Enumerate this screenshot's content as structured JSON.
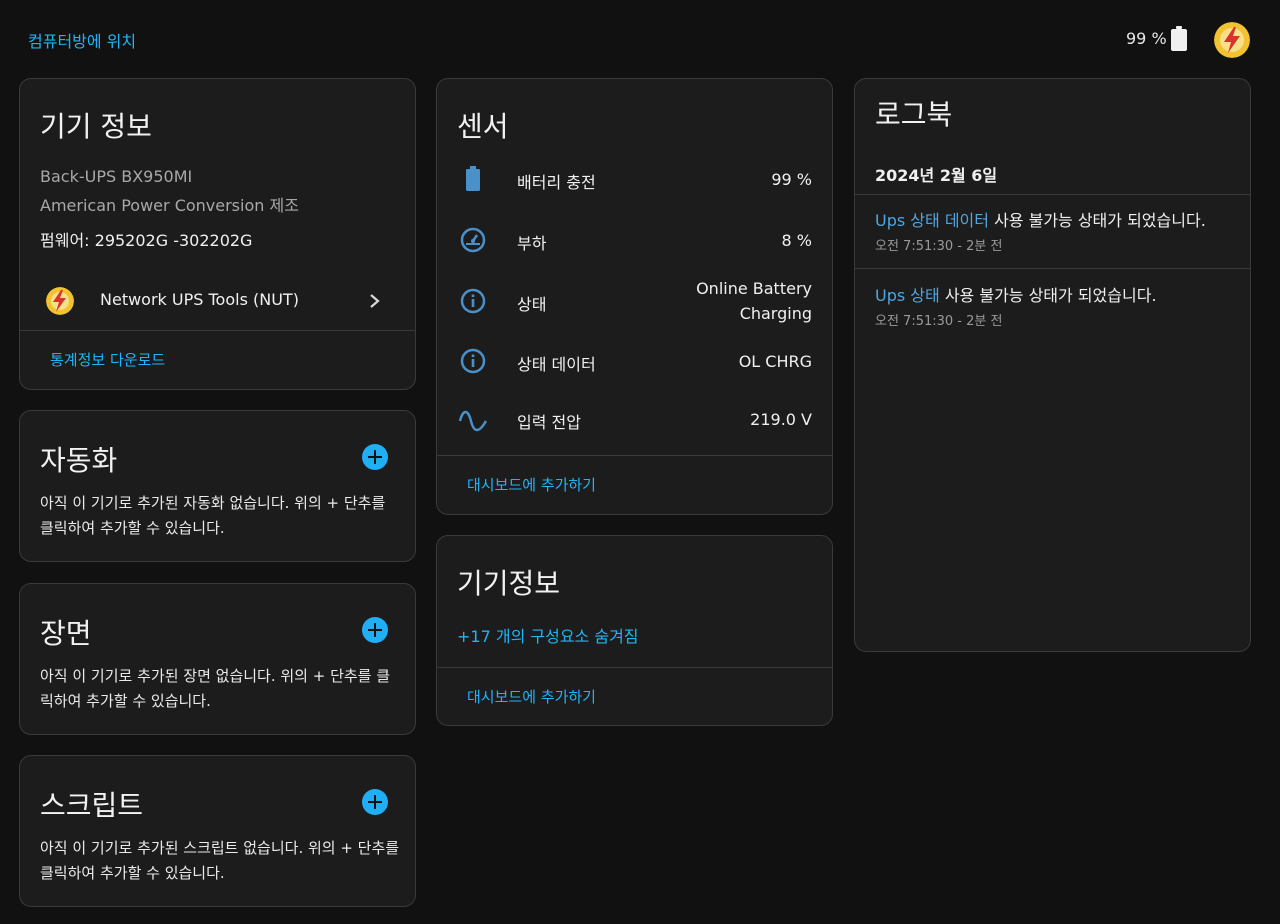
{
  "topbar": {
    "area_link": "컴퓨터방에 위치",
    "battery_text": "99 %",
    "battery_icon": "battery-full-icon",
    "avatar_icon": "lightning-logo-icon"
  },
  "device_card": {
    "title": "기기 정보",
    "model": "Back-UPS BX950MI",
    "manufacturer": "American Power Conversion 제조",
    "firmware": "펌웨어: 295202G -302202G",
    "integration_label": "Network UPS Tools (NUT)",
    "integration_icon": "nut-logo-icon",
    "download_link": "통계정보 다운로드"
  },
  "automation_card": {
    "title": "자동화",
    "text": "아직 이 기기로 추가된 자동화 없습니다. 위의 + 단추를 클릭하여 추가할 수 있습니다."
  },
  "scene_card": {
    "title": "장면",
    "text": "아직 이 기기로 추가된 장면 없습니다. 위의 + 단추를 클릭하여 추가할 수 있습니다."
  },
  "script_card": {
    "title": "스크립트",
    "text": "아직 이 기기로 추가된 스크립트 없습니다. 위의 + 단추를 클릭하여 추가할 수 있습니다."
  },
  "sensors_card": {
    "title": "센서",
    "rows": [
      {
        "icon": "battery-icon",
        "label": "배터리 충전",
        "value": "99 %"
      },
      {
        "icon": "gauge-icon",
        "label": "부하",
        "value": "8 %"
      },
      {
        "icon": "info-icon",
        "label": "상태",
        "value": "Online Battery Charging"
      },
      {
        "icon": "info-icon",
        "label": "상태 데이터",
        "value": "OL CHRG"
      },
      {
        "icon": "sine-wave-icon",
        "label": "입력 전압",
        "value": "219.0 V"
      }
    ],
    "add_dashboard": "대시보드에 추가하기"
  },
  "devinfo2_card": {
    "title": "기기정보",
    "hidden_link": "+17 개의 구성요소 숨겨짐",
    "add_dashboard": "대시보드에 추가하기"
  },
  "logbook_card": {
    "title": "로그북",
    "date": "2024년 2월 6일",
    "entries": [
      {
        "entity": "Ups 상태 데이터",
        "message": " 사용 불가능 상태가 되었습니다.",
        "time": "오전 7:51:30 - 2분 전"
      },
      {
        "entity": "Ups 상태",
        "message": " 사용 불가능 상태가 되었습니다.",
        "time": "오전 7:51:30 - 2분 전"
      }
    ]
  },
  "colors": {
    "accent": "#03a9f4",
    "background": "#111111",
    "card": "#1c1c1c",
    "icon": "#4a90c9"
  }
}
